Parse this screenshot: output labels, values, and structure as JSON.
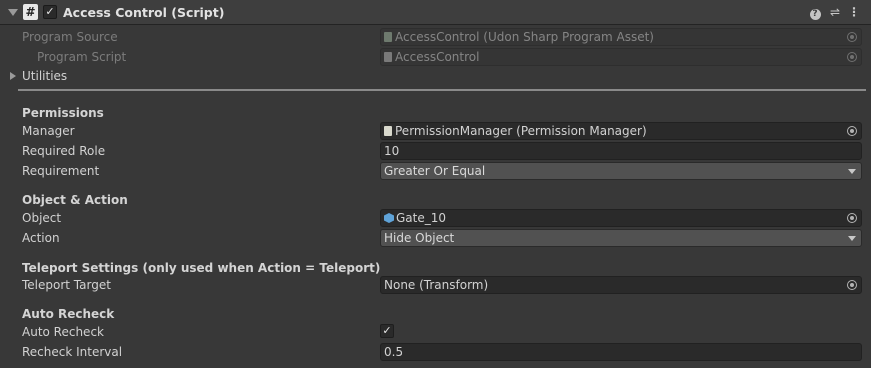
{
  "header": {
    "script_icon": "#",
    "enabled_check": "✓",
    "title": "Access Control (Script)",
    "help_icon": "?",
    "preset_icon": "⇌",
    "menu_icon": "⋮"
  },
  "program_source": {
    "label": "Program Source",
    "value": "AccessControl (Udon Sharp Program Asset)"
  },
  "program_script": {
    "label": "Program Script",
    "value": "AccessControl"
  },
  "utilities": {
    "label": "Utilities"
  },
  "permissions": {
    "heading": "Permissions",
    "manager": {
      "label": "Manager",
      "value": "PermissionManager (Permission Manager)"
    },
    "required_role": {
      "label": "Required Role",
      "value": "10"
    },
    "requirement": {
      "label": "Requirement",
      "value": "Greater Or Equal"
    }
  },
  "object_action": {
    "heading": "Object & Action",
    "object": {
      "label": "Object",
      "value": "Gate_10"
    },
    "action": {
      "label": "Action",
      "value": "Hide Object"
    }
  },
  "teleport": {
    "heading": "Teleport Settings (only used when Action = Teleport)",
    "target": {
      "label": "Teleport Target",
      "value": "None (Transform)"
    }
  },
  "auto_recheck": {
    "heading": "Auto Recheck",
    "enabled": {
      "label": "Auto Recheck",
      "check": "✓"
    },
    "interval": {
      "label": "Recheck Interval",
      "value": "0.5"
    }
  }
}
